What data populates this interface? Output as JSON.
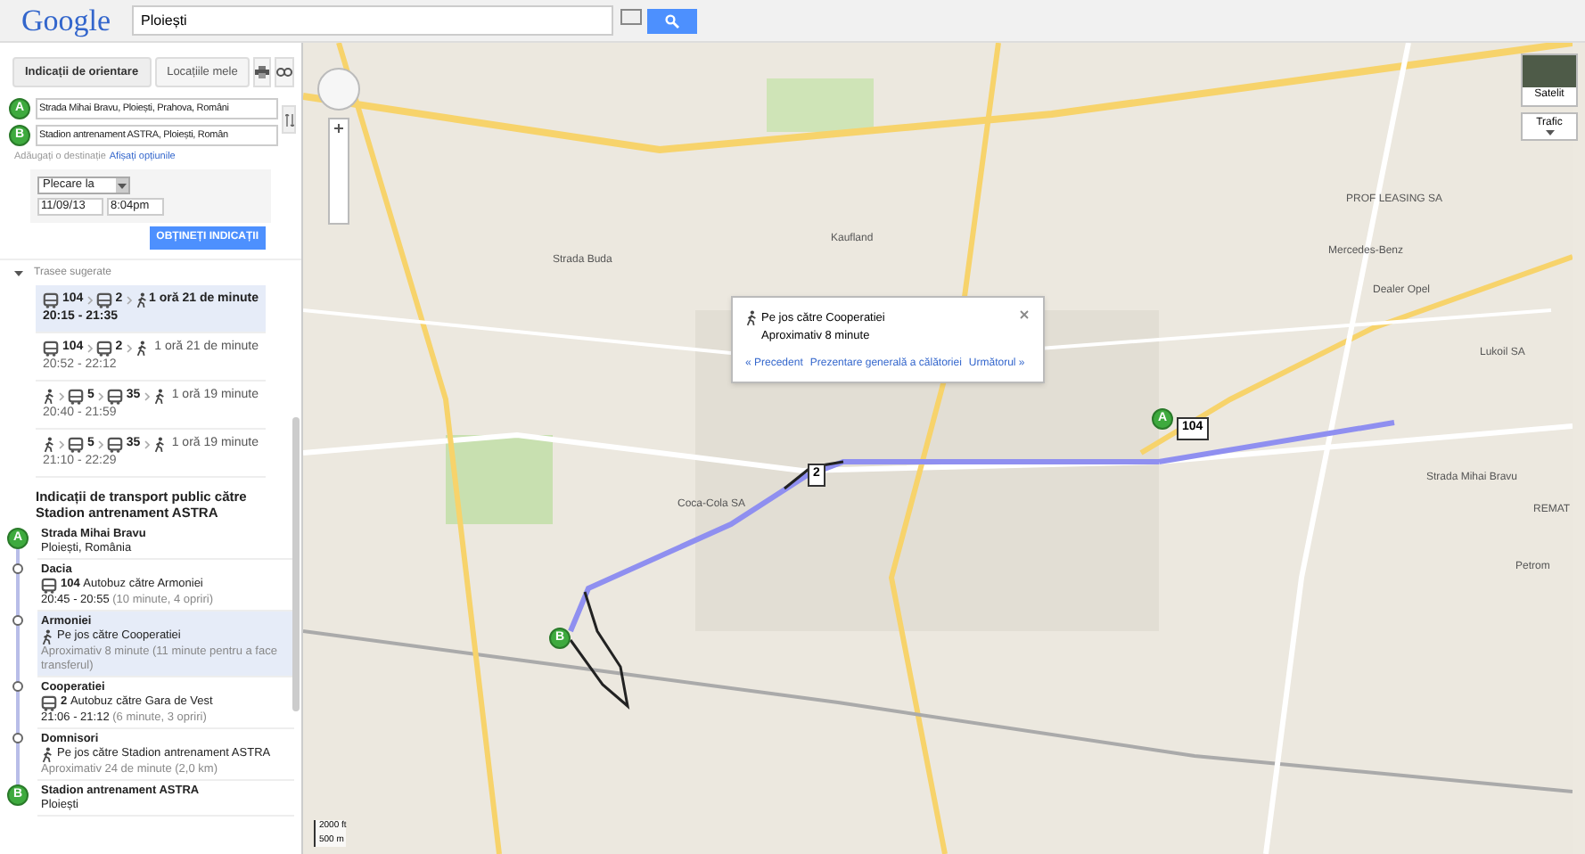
{
  "header": {
    "logo": "Google",
    "search_value": "Ploiești"
  },
  "panel": {
    "tabs": [
      {
        "label": "Indicații de orientare",
        "selected": true
      },
      {
        "label": "Locațiile mele",
        "selected": false
      }
    ],
    "waypoints": [
      {
        "letter": "A",
        "value": "Strada Mihai Bravu, Ploiești, Prahova, Români"
      },
      {
        "letter": "B",
        "value": "Stadion antrenament ASTRA, Ploiești, Român"
      }
    ],
    "add_destination": "Adăugați o destinație",
    "show_options": "Afișați opțiunile",
    "depart_select": "Plecare la",
    "date": "11/09/13",
    "time": "8:04pm",
    "get_directions": "OBȚINEȚI INDICAȚII",
    "suggested_title": "Trasee sugerate",
    "routes": [
      {
        "selected": true,
        "segments": [
          {
            "kind": "bus",
            "label": "104"
          },
          {
            "kind": "bus",
            "label": "2"
          },
          {
            "kind": "walk"
          }
        ],
        "duration": "1 oră 21 de minute",
        "times": "20:15 - 21:35"
      },
      {
        "selected": false,
        "segments": [
          {
            "kind": "bus",
            "label": "104"
          },
          {
            "kind": "bus",
            "label": "2"
          },
          {
            "kind": "walk"
          }
        ],
        "duration": "1 oră 21 de minute",
        "times": "20:52 - 22:12"
      },
      {
        "selected": false,
        "segments": [
          {
            "kind": "walk"
          },
          {
            "kind": "bus",
            "label": "5"
          },
          {
            "kind": "bus",
            "label": "35"
          },
          {
            "kind": "walk"
          }
        ],
        "duration": "1 oră 19 minute",
        "times": "20:40 - 21:59"
      },
      {
        "selected": false,
        "segments": [
          {
            "kind": "walk"
          },
          {
            "kind": "bus",
            "label": "5"
          },
          {
            "kind": "bus",
            "label": "35"
          },
          {
            "kind": "walk"
          }
        ],
        "duration": "1 oră 19 minute",
        "times": "21:10 - 22:29"
      }
    ],
    "directions_title": "Indicații de transport public către Stadion antrenament ASTRA",
    "steps": [
      {
        "kind": "start",
        "marker": "A",
        "title": "Strada Mihai Bravu",
        "lines": [
          {
            "kind": "text",
            "text": "Ploiești, România"
          }
        ],
        "selected": false
      },
      {
        "kind": "stop",
        "title": "Dacia",
        "lines": [
          {
            "kind": "bus",
            "bold": "104",
            "text": "Autobuz către Armoniei"
          },
          {
            "kind": "text",
            "text": "20:45 - 20:55",
            "muted": "(10 minute, 4 opriri)"
          }
        ],
        "selected": false
      },
      {
        "kind": "stop",
        "title": "Armoniei",
        "lines": [
          {
            "kind": "walk",
            "text": "Pe jos către Cooperatiei"
          },
          {
            "kind": "text",
            "muted": "Aproximativ 8 minute (11 minute pentru a face transferul)"
          }
        ],
        "selected": true
      },
      {
        "kind": "stop",
        "title": "Cooperatiei",
        "lines": [
          {
            "kind": "bus",
            "bold": "2",
            "text": "Autobuz către Gara de Vest"
          },
          {
            "kind": "text",
            "text": "21:06 - 21:12",
            "muted": "(6 minute, 3 opriri)"
          }
        ],
        "selected": false
      },
      {
        "kind": "stop",
        "title": "Domnisori",
        "lines": [
          {
            "kind": "walk",
            "text": "Pe jos către Stadion antrenament ASTRA"
          },
          {
            "kind": "text",
            "muted": "Aproximativ 24 de minute (2,0 km)"
          }
        ],
        "selected": false
      },
      {
        "kind": "end",
        "marker": "B",
        "title": "Stadion antrenament ASTRA",
        "lines": [
          {
            "kind": "text",
            "text": "Ploiești"
          }
        ],
        "selected": false
      }
    ]
  },
  "map": {
    "popup": {
      "title": "Pe jos către Cooperatiei",
      "subtitle": "Aproximativ 8 minute",
      "links": [
        "« Precedent",
        "Prezentare generală a călătoriei",
        "Următorul »"
      ]
    },
    "map_types": [
      {
        "label": "Satelit"
      },
      {
        "label": "Trafic"
      }
    ],
    "labels": [
      "PROF LEASING SA",
      "Kaufland",
      "Mercedes-Benz",
      "Strada Buda",
      "Dealer Opel",
      "Lukoil SA",
      "Strada Mihai Bravu",
      "Coca-Cola SA",
      "REMAT",
      "Petrom"
    ],
    "route_badges": [
      "104",
      "2"
    ],
    "end_markers": [
      "A",
      "B"
    ],
    "scale": [
      "2000 ft",
      "500 m"
    ]
  }
}
